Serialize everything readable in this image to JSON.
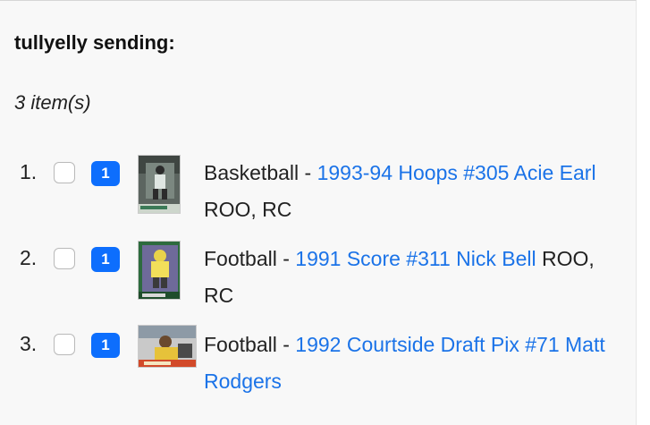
{
  "sender": {
    "title": "tullyelly sending:"
  },
  "summary": {
    "item_count": "3 item(s)"
  },
  "items": [
    {
      "index": "1.",
      "quantity": "1",
      "sport": "Basketball",
      "separator": " - ",
      "card_title": "1993-94 Hoops #305 Acie Earl",
      "attributes": " ROO, RC",
      "thumbnail_icon": "basketball-card-thumbnail"
    },
    {
      "index": "2.",
      "quantity": "1",
      "sport": "Football",
      "separator": " - ",
      "card_title": "1991 Score #311 Nick Bell",
      "attributes": " ROO, RC",
      "thumbnail_icon": "football-card-thumbnail"
    },
    {
      "index": "3.",
      "quantity": "1",
      "sport": "Football",
      "separator": " - ",
      "card_title": "1992 Courtside Draft Pix #71 Matt Rodgers",
      "attributes": "",
      "thumbnail_icon": "football-card-thumbnail"
    }
  ],
  "colors": {
    "link": "#1b73e8",
    "badge": "#0d6efd",
    "panel_background": "#f8f8f8"
  }
}
